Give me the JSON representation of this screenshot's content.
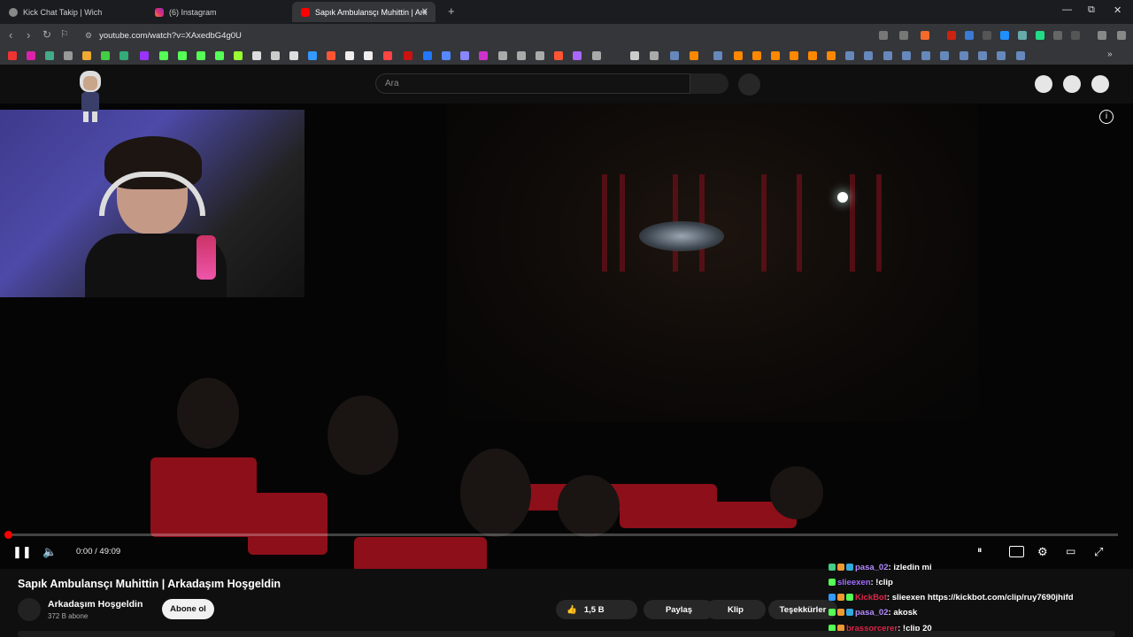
{
  "browser": {
    "tabs": [
      {
        "title": "Kick Chat Takip | Wich",
        "favicon": "globe-icon",
        "active": false
      },
      {
        "title": "(6) Instagram",
        "favicon": "instagram-icon",
        "active": false
      },
      {
        "title": "Sapık Ambulansçı Muhittin | Ark",
        "favicon": "youtube-icon",
        "active": true
      }
    ],
    "new_tab": "+",
    "url": "youtube.com/watch?v=XAxedbG4g0U",
    "window_controls": {
      "minimize": "—",
      "maximize": "⧉",
      "close": "✕"
    }
  },
  "youtube": {
    "search_placeholder": "Ara",
    "video": {
      "title": "Sapık Ambulansçı Muhittin | Arkadaşım Hoşgeldin",
      "time": "0:00 / 49:09",
      "progress": 0.001
    },
    "channel": {
      "name": "Arkadaşım Hoşgeldin",
      "subscribers": "372 B abone",
      "subscribe_label": "Abone ol"
    },
    "actions": {
      "likes": "1,5 B",
      "share": "Paylaş",
      "clip": "Klip",
      "thanks": "Teşekkürler"
    }
  },
  "chat": [
    {
      "user": "pasa_02",
      "color": "#b38bff",
      "text": ": izledin mi"
    },
    {
      "user": "slieexen",
      "color": "#a06bff",
      "text": ": !clip"
    },
    {
      "user": "KickBot",
      "color": "#e0254a",
      "text": ": slieexen https://kickbot.com/clip/ruy7690jhifd"
    },
    {
      "user": "pasa_02",
      "color": "#b38bff",
      "text": ": akosk"
    },
    {
      "user": "brassorcerer",
      "color": "#e0254a",
      "text": ": !clip 20"
    }
  ],
  "colors": {
    "accent": "#ff0000",
    "background": "#0f0f0f"
  }
}
